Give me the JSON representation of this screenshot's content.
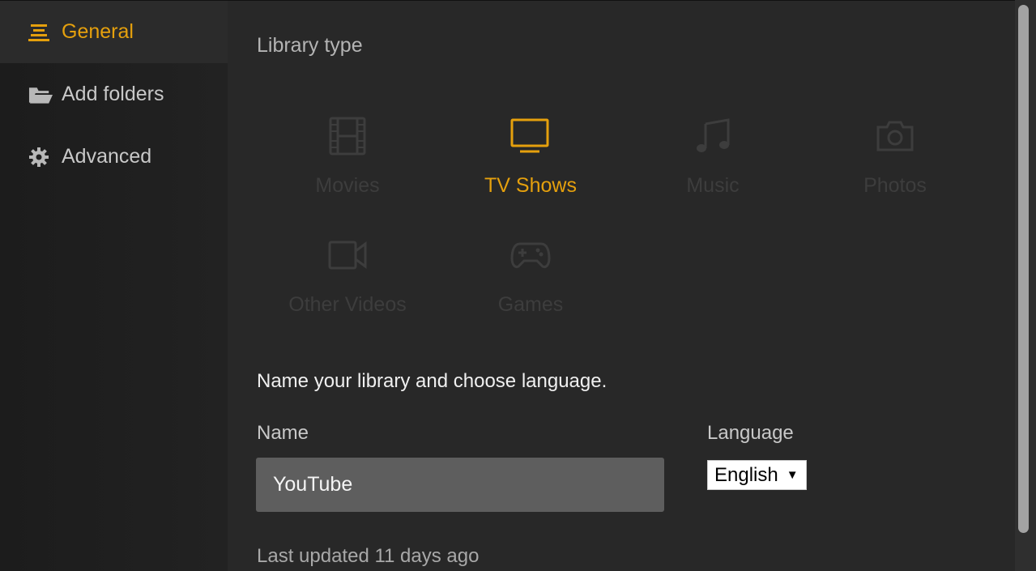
{
  "sidebar": {
    "items": [
      {
        "label": "General",
        "icon": "list-icon",
        "active": true
      },
      {
        "label": "Add folders",
        "icon": "folder-open-icon",
        "active": false
      },
      {
        "label": "Advanced",
        "icon": "gear-icon",
        "active": false
      }
    ]
  },
  "main": {
    "section_title": "Library type",
    "library_types": [
      {
        "label": "Movies",
        "icon": "film-icon",
        "selected": false
      },
      {
        "label": "TV Shows",
        "icon": "tv-icon",
        "selected": true
      },
      {
        "label": "Music",
        "icon": "music-note-icon",
        "selected": false
      },
      {
        "label": "Photos",
        "icon": "camera-icon",
        "selected": false
      },
      {
        "label": "Other Videos",
        "icon": "video-camera-icon",
        "selected": false
      },
      {
        "label": "Games",
        "icon": "gamepad-icon",
        "selected": false
      }
    ],
    "prompt": "Name your library and choose language.",
    "name_label": "Name",
    "name_value": "YouTube",
    "language_label": "Language",
    "language_value": "English",
    "last_updated": "Last updated 11 days ago"
  },
  "colors": {
    "accent": "#e5a00d",
    "background": "#282828",
    "sidebar": "#1e1e1e",
    "input": "#5e5e5e"
  }
}
